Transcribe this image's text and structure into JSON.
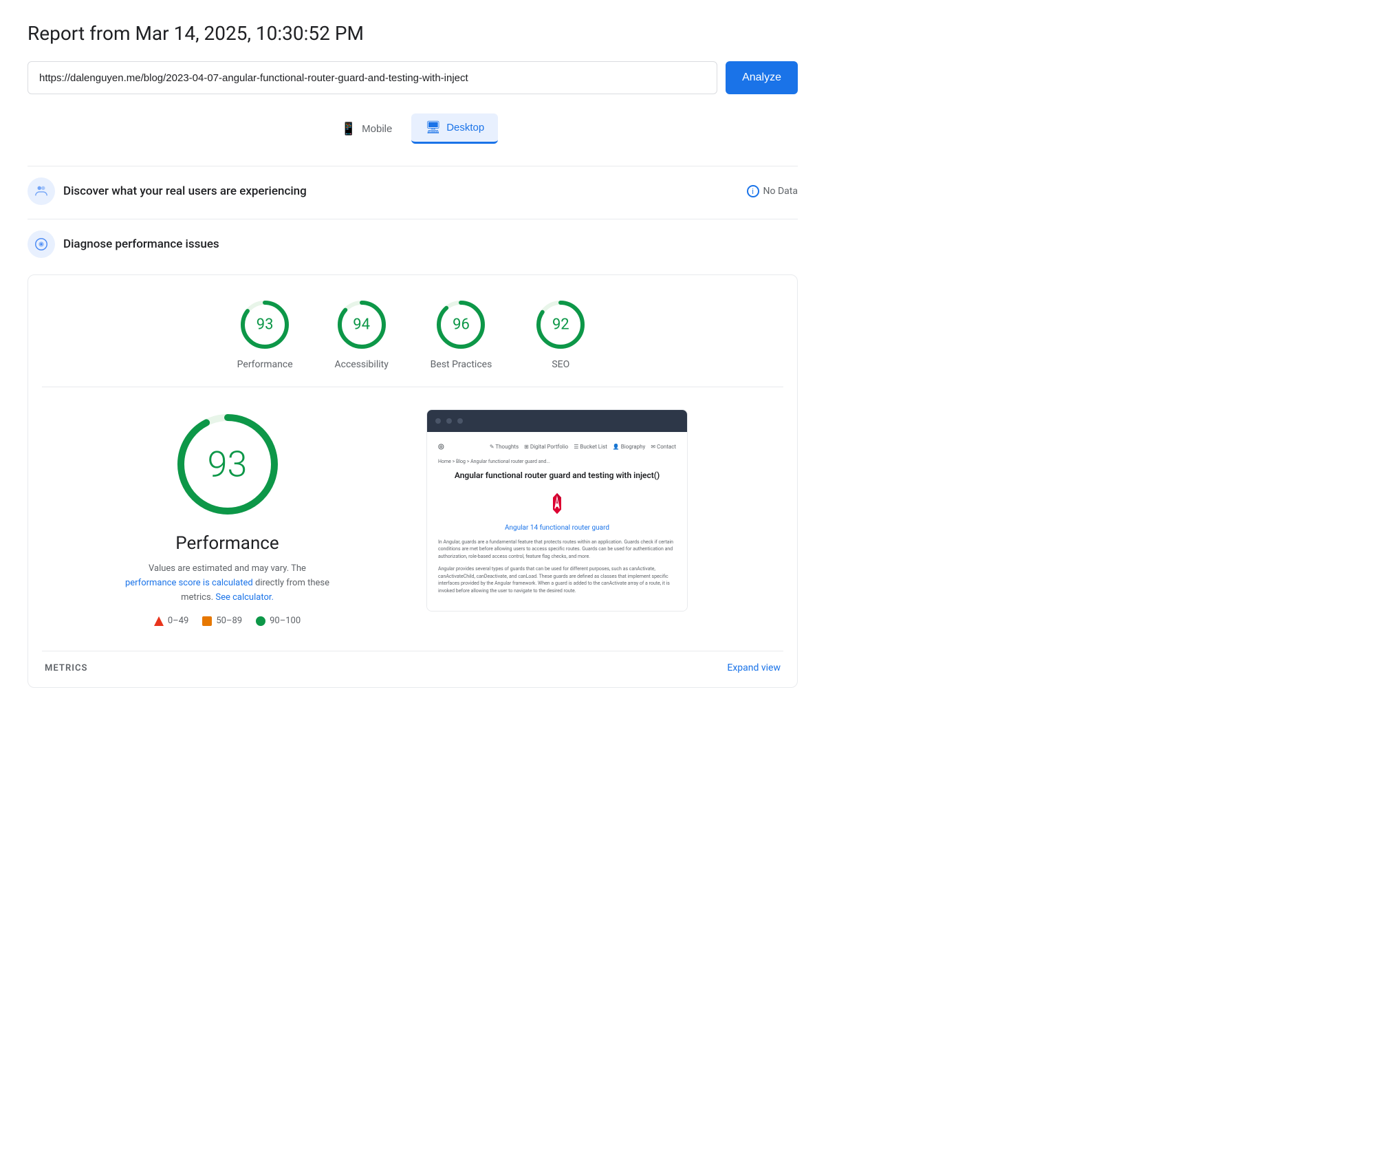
{
  "header": {
    "title": "Report from Mar 14, 2025, 10:30:52 PM"
  },
  "urlbar": {
    "value": "https://dalenguyen.me/blog/2023-04-07-angular-functional-router-guard-and-testing-with-inject",
    "placeholder": "Enter a URL"
  },
  "analyze_button": "Analyze",
  "device_tabs": [
    {
      "id": "mobile",
      "label": "Mobile",
      "active": false
    },
    {
      "id": "desktop",
      "label": "Desktop",
      "active": true
    }
  ],
  "real_users_section": {
    "title": "Discover what your real users are experiencing",
    "status": "No Data"
  },
  "diagnose_section": {
    "title": "Diagnose performance issues"
  },
  "scores": [
    {
      "id": "performance",
      "value": 93,
      "label": "Performance",
      "color": "#0d9748"
    },
    {
      "id": "accessibility",
      "value": 94,
      "label": "Accessibility",
      "color": "#0d9748"
    },
    {
      "id": "best-practices",
      "value": 96,
      "label": "Best Practices",
      "color": "#0d9748"
    },
    {
      "id": "seo",
      "value": 92,
      "label": "SEO",
      "color": "#0d9748"
    }
  ],
  "performance_detail": {
    "score": 93,
    "title": "Performance",
    "description_text": "Values are estimated and may vary. The",
    "description_link": "performance score is calculated",
    "description_text2": "directly from these metrics.",
    "calculator_link": "See calculator.",
    "legend": [
      {
        "id": "fail",
        "range": "0–49",
        "type": "triangle",
        "color": "#e8341c"
      },
      {
        "id": "average",
        "range": "50–89",
        "type": "square",
        "color": "#e67700"
      },
      {
        "id": "pass",
        "range": "90–100",
        "type": "dot",
        "color": "#0d9748"
      }
    ]
  },
  "screenshot": {
    "nav_logo": "◎",
    "nav_links": [
      "✎ Thoughts",
      "⊞ Digital Portfolio",
      "☰ Bucket List",
      "👤 Biography",
      "✉ Contact"
    ],
    "breadcrumb": "Home > Blog > Angular functional router guard and...",
    "article_title": "Angular functional router guard and testing with inject()",
    "link_title": "Angular 14 functional router guard",
    "text_block1": "In Angular, guards are a fundamental feature that protects routes within an application. Guards check if certain conditions are met before allowing users to access specific routes. Guards can be used for authentication and authorization, role-based access control, feature flag checks, and more.",
    "text_block2": "Angular provides several types of guards that can be used for different purposes, such as canActivate, canActivateChild, canDeactivate, and canLoad. These guards are defined as classes that implement specific interfaces provided by the Angular framework. When a guard is added to the canActivate array of a route, it is invoked before allowing the user to navigate to the desired route."
  },
  "bottom": {
    "metrics_label": "METRICS",
    "expand_label": "Expand view"
  }
}
